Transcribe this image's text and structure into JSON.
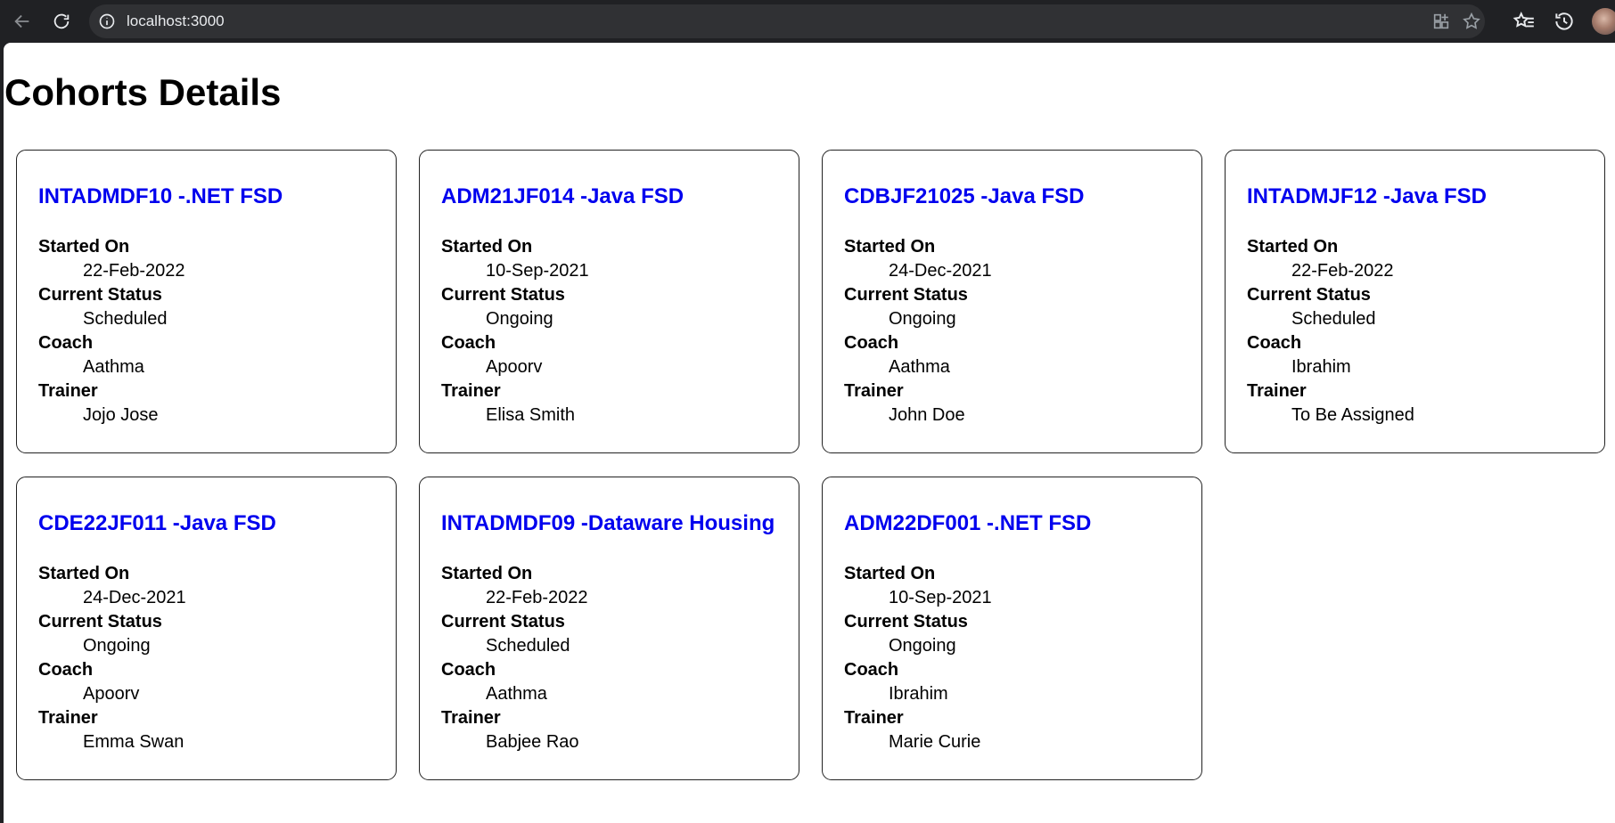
{
  "browser": {
    "url": "localhost:3000"
  },
  "page": {
    "title": "Cohorts Details"
  },
  "labels": {
    "started_on": "Started On",
    "current_status": "Current Status",
    "coach": "Coach",
    "trainer": "Trainer"
  },
  "cohorts": [
    {
      "title": "INTADMDF10 -.NET FSD",
      "started_on": "22-Feb-2022",
      "status": "Scheduled",
      "coach": "Aathma",
      "trainer": "Jojo Jose"
    },
    {
      "title": "ADM21JF014 -Java FSD",
      "started_on": "10-Sep-2021",
      "status": "Ongoing",
      "coach": "Apoorv",
      "trainer": "Elisa Smith"
    },
    {
      "title": "CDBJF21025 -Java FSD",
      "started_on": "24-Dec-2021",
      "status": "Ongoing",
      "coach": "Aathma",
      "trainer": "John Doe"
    },
    {
      "title": "INTADMJF12 -Java FSD",
      "started_on": "22-Feb-2022",
      "status": "Scheduled",
      "coach": "Ibrahim",
      "trainer": "To Be Assigned"
    },
    {
      "title": "CDE22JF011 -Java FSD",
      "started_on": "24-Dec-2021",
      "status": "Ongoing",
      "coach": "Apoorv",
      "trainer": "Emma Swan"
    },
    {
      "title": "INTADMDF09 -Dataware Housing",
      "started_on": "22-Feb-2022",
      "status": "Scheduled",
      "coach": "Aathma",
      "trainer": "Babjee Rao"
    },
    {
      "title": "ADM22DF001 -.NET FSD",
      "started_on": "10-Sep-2021",
      "status": "Ongoing",
      "coach": "Ibrahim",
      "trainer": "Marie Curie"
    }
  ]
}
